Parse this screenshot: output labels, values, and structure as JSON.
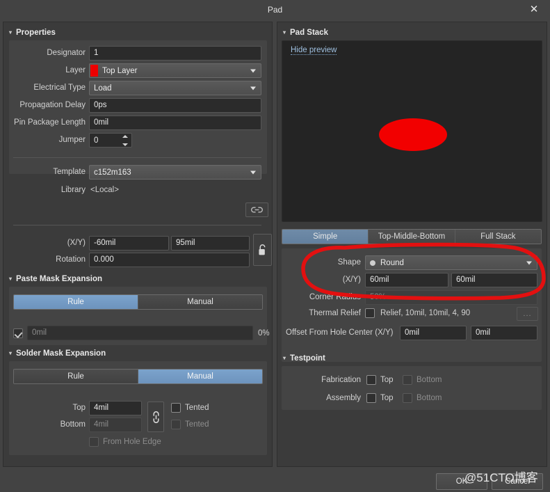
{
  "window": {
    "title": "Pad",
    "close_icon": "close-icon"
  },
  "properties": {
    "section_title": "Properties",
    "designator": {
      "label": "Designator",
      "value": "1"
    },
    "layer": {
      "label": "Layer",
      "value": "Top Layer",
      "swatch_color": "#ee0000"
    },
    "electrical_type": {
      "label": "Electrical Type",
      "value": "Load"
    },
    "propagation_delay": {
      "label": "Propagation Delay",
      "value": "0ps"
    },
    "pin_package_length": {
      "label": "Pin Package Length",
      "value": "0mil"
    },
    "jumper": {
      "label": "Jumper",
      "value": "0"
    },
    "template": {
      "label": "Template",
      "value": "c152m163"
    },
    "library": {
      "label": "Library",
      "value": "<Local>",
      "link_icon": "link-icon"
    },
    "position": {
      "label": "(X/Y)",
      "x": "-60mil",
      "y": "95mil"
    },
    "rotation": {
      "label": "Rotation",
      "value": "0.000"
    },
    "lock_icon": "unlocked-padlock-icon"
  },
  "paste_mask": {
    "section_title": "Paste Mask Expansion",
    "modes": [
      "Rule",
      "Manual"
    ],
    "active_mode": "Rule",
    "checkbox_checked": true,
    "value_placeholder": "0mil",
    "percent": "0%"
  },
  "solder_mask": {
    "section_title": "Solder Mask Expansion",
    "modes": [
      "Rule",
      "Manual"
    ],
    "active_mode": "Manual",
    "top": {
      "label": "Top",
      "value": "4mil",
      "tented_label": "Tented",
      "tented_checked": false
    },
    "bottom": {
      "label": "Bottom",
      "value": "4mil",
      "tented_label": "Tented",
      "tented_checked": false
    },
    "from_hole_edge": {
      "label": "From Hole Edge",
      "checked": false
    },
    "link_icon": "chain-link-icon"
  },
  "pad_stack": {
    "section_title": "Pad Stack",
    "hide_preview_label": "Hide preview",
    "pad_color": "#f20000",
    "tabs": [
      "Simple",
      "Top-Middle-Bottom",
      "Full Stack"
    ],
    "active_tab": "Simple",
    "shape": {
      "label": "Shape",
      "value": "Round"
    },
    "size": {
      "label": "(X/Y)",
      "x": "60mil",
      "y": "60mil"
    },
    "corner_radius": {
      "label": "Corner Radius",
      "value": "50%"
    },
    "thermal_relief": {
      "label": "Thermal Relief",
      "checked": false,
      "value": "Relief, 10mil, 10mil, 4, 90",
      "more_label": "..."
    },
    "offset_from_hole_center": {
      "label": "Offset From Hole Center (X/Y)",
      "x": "0mil",
      "y": "0mil"
    }
  },
  "testpoint": {
    "section_title": "Testpoint",
    "fabrication": {
      "label": "Fabrication",
      "top_label": "Top",
      "bottom_label": "Bottom",
      "top_checked": false,
      "bottom_checked": false
    },
    "assembly": {
      "label": "Assembly",
      "top_label": "Top",
      "bottom_label": "Bottom",
      "top_checked": false,
      "bottom_checked": false
    }
  },
  "footer": {
    "ok_label": "OK",
    "cancel_label": "Cancel"
  },
  "annotation": {
    "color": "#e31010",
    "shape": "hand-drawn-ellipse"
  },
  "watermark": {
    "text": "@51CTO博客"
  }
}
